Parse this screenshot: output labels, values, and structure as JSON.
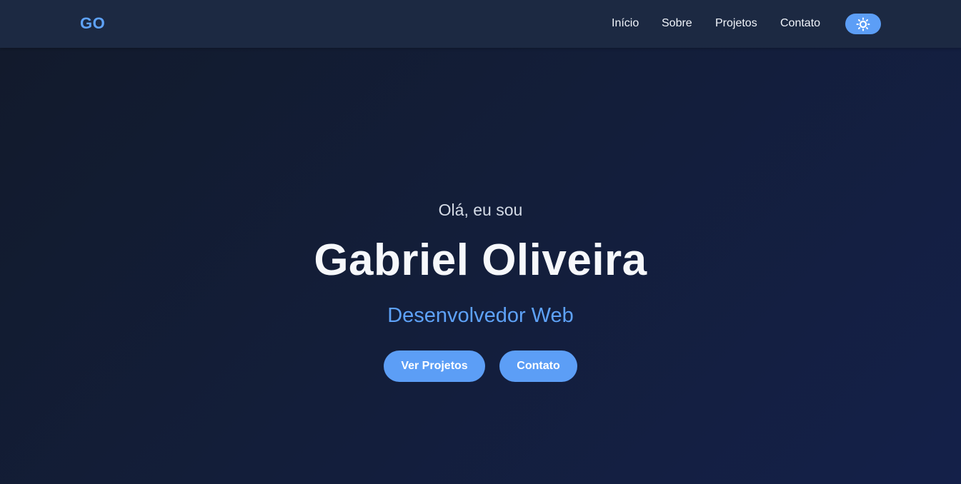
{
  "nav": {
    "logo": "GO",
    "links": [
      {
        "label": "Início"
      },
      {
        "label": "Sobre"
      },
      {
        "label": "Projetos"
      },
      {
        "label": "Contato"
      }
    ],
    "theme_toggle_icon": "sun-icon"
  },
  "hero": {
    "greeting": "Olá, eu sou",
    "name": "Gabriel Oliveira",
    "role": "Desenvolvedor Web",
    "buttons": {
      "projects": "Ver Projetos",
      "contact": "Contato"
    }
  },
  "colors": {
    "accent": "#5c9ef6",
    "navbar_bg": "#1c2942",
    "page_bg": "#131e3a"
  }
}
